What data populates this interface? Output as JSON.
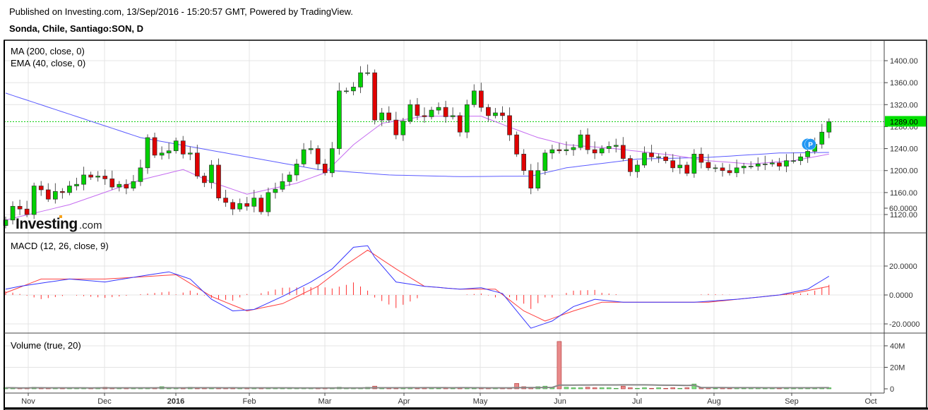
{
  "header": {
    "published": "Published on Investing.com, 13/Sep/2016 - 15:20:57 GMT, Powered by TradingView.",
    "symbol": "Sonda, Chile, Santiago:SON, D"
  },
  "logo": {
    "text_main": "Investing",
    "text_suffix": ".com"
  },
  "chart_data": {
    "type": "candlestick",
    "title": "Sonda, Chile, Santiago:SON, D",
    "x_tick_labels": [
      "Nov",
      "Dec",
      "2016",
      "Feb",
      "Mar",
      "Apr",
      "May",
      "Jun",
      "Jul",
      "Aug",
      "Sep",
      "Oct"
    ],
    "price_panel": {
      "indicators": [
        "MA (200, close, 0)",
        "EMA (40, close, 0)"
      ],
      "y_ticks": [
        "1400.00",
        "1360.00",
        "1320.00",
        "1280.00",
        "1240.00",
        "1200.00",
        "1160.00",
        "1120.00"
      ],
      "ylim": [
        1100,
        1418
      ],
      "last_price": 1289,
      "last_price_label": "1289.00",
      "closes": [
        1110,
        1135,
        1130,
        1120,
        1172,
        1165,
        1148,
        1162,
        1160,
        1172,
        1175,
        1192,
        1188,
        1190,
        1185,
        1170,
        1175,
        1168,
        1180,
        1205,
        1260,
        1228,
        1232,
        1236,
        1254,
        1230,
        1232,
        1190,
        1178,
        1210,
        1150,
        1142,
        1130,
        1140,
        1135,
        1150,
        1125,
        1160,
        1166,
        1180,
        1192,
        1212,
        1238,
        1240,
        1212,
        1196,
        1240,
        1345,
        1345,
        1352,
        1378,
        1378,
        1292,
        1305,
        1292,
        1265,
        1290,
        1320,
        1300,
        1298,
        1310,
        1315,
        1298,
        1300,
        1270,
        1320,
        1345,
        1315,
        1300,
        1305,
        1300,
        1265,
        1230,
        1200,
        1168,
        1200,
        1232,
        1238,
        1236,
        1238,
        1242,
        1265,
        1238,
        1232,
        1240,
        1244,
        1246,
        1222,
        1198,
        1210,
        1232,
        1225,
        1225,
        1218,
        1205,
        1210,
        1195,
        1230,
        1215,
        1205,
        1205,
        1200,
        1196,
        1205,
        1208,
        1208,
        1212,
        1212,
        1214,
        1208,
        1218,
        1218,
        1225,
        1235,
        1248,
        1270,
        1289
      ],
      "first_open": 1100,
      "ma200": [
        [
          0,
          1341
        ],
        [
          19,
          1260
        ],
        [
          34,
          1225
        ],
        [
          44,
          1202
        ],
        [
          54,
          1192
        ],
        [
          64,
          1189
        ],
        [
          74,
          1190
        ],
        [
          79,
          1205
        ],
        [
          89,
          1221
        ],
        [
          99,
          1224
        ],
        [
          109,
          1232
        ],
        [
          116,
          1233
        ]
      ],
      "ema40": [
        [
          0,
          1110
        ],
        [
          9,
          1138
        ],
        [
          19,
          1183
        ],
        [
          25,
          1202
        ],
        [
          29,
          1179
        ],
        [
          34,
          1157
        ],
        [
          41,
          1177
        ],
        [
          45,
          1196
        ],
        [
          49,
          1247
        ],
        [
          53,
          1286
        ],
        [
          59,
          1299
        ],
        [
          67,
          1299
        ],
        [
          71,
          1279
        ],
        [
          75,
          1260
        ],
        [
          79,
          1247
        ],
        [
          85,
          1241
        ],
        [
          94,
          1228
        ],
        [
          99,
          1218
        ],
        [
          105,
          1212
        ],
        [
          111,
          1218
        ],
        [
          116,
          1230
        ]
      ],
      "marker_label": "P"
    },
    "macd_panel": {
      "label": "MACD (12, 26, close, 9)",
      "y_ticks": [
        "60.0000",
        "20.0000",
        "0.0000",
        "-20.0000"
      ],
      "ylim": [
        -38,
        60
      ],
      "macd": [
        [
          0,
          4
        ],
        [
          2,
          6
        ],
        [
          9,
          11
        ],
        [
          14,
          9
        ],
        [
          19,
          13
        ],
        [
          23,
          16
        ],
        [
          26,
          11
        ],
        [
          29,
          -3
        ],
        [
          32,
          -11
        ],
        [
          35,
          -10
        ],
        [
          39,
          -1
        ],
        [
          43,
          9
        ],
        [
          46,
          18
        ],
        [
          49,
          33
        ],
        [
          51,
          34
        ],
        [
          52,
          26
        ],
        [
          55,
          9
        ],
        [
          59,
          6
        ],
        [
          64,
          4
        ],
        [
          67,
          5
        ],
        [
          70,
          1
        ],
        [
          72,
          -11
        ],
        [
          74,
          -23
        ],
        [
          77,
          -18
        ],
        [
          80,
          -8
        ],
        [
          83,
          -3
        ],
        [
          87,
          -5
        ],
        [
          91,
          -5
        ],
        [
          97,
          -5
        ],
        [
          103,
          -3
        ],
        [
          109,
          0
        ],
        [
          113,
          4
        ],
        [
          115,
          10
        ],
        [
          116,
          13
        ]
      ],
      "signal": [
        [
          0,
          1.5
        ],
        [
          5,
          11
        ],
        [
          14,
          11
        ],
        [
          24,
          14
        ],
        [
          29,
          -1
        ],
        [
          34,
          -11
        ],
        [
          39,
          -6
        ],
        [
          44,
          6
        ],
        [
          48,
          21
        ],
        [
          51,
          31
        ],
        [
          55,
          18
        ],
        [
          59,
          6
        ],
        [
          64,
          4
        ],
        [
          69,
          4
        ],
        [
          73,
          -11
        ],
        [
          76,
          -18
        ],
        [
          80,
          -11
        ],
        [
          84,
          -5
        ],
        [
          89,
          -5
        ],
        [
          99,
          -5
        ],
        [
          105,
          -2
        ],
        [
          111,
          1
        ],
        [
          116,
          6
        ]
      ]
    },
    "volume_panel": {
      "label": "Volume (true, 20)",
      "y_ticks": [
        "40M",
        "20M",
        "0"
      ],
      "ylim": [
        0,
        48
      ],
      "volumes_m": [
        1,
        1,
        0.5,
        1,
        1.5,
        1,
        0.5,
        1,
        0.5,
        1,
        1,
        1,
        0.5,
        1,
        1.5,
        1,
        0.5,
        1,
        0.5,
        1,
        1,
        1,
        2,
        1,
        1,
        1,
        1.5,
        0.5,
        1,
        0.5,
        1,
        0.5,
        1,
        0.5,
        1,
        0.5,
        1,
        0.5,
        1,
        0.5,
        1,
        0.5,
        1,
        1,
        0.5,
        1,
        1,
        1.5,
        1,
        1,
        1,
        1.5,
        2.5,
        1,
        1,
        0.5,
        1,
        1,
        0.5,
        1,
        1,
        0.5,
        1,
        0.5,
        1,
        1,
        0.5,
        1,
        0.5,
        1,
        1,
        1,
        5,
        2,
        1.5,
        2,
        2.5,
        1.5,
        44,
        1.5,
        1,
        1,
        1.5,
        1,
        1,
        1,
        0.5,
        2.5,
        1,
        0.5,
        1,
        0.5,
        1,
        0.5,
        1,
        0.5,
        1,
        4.5,
        1,
        1,
        0.5,
        1,
        0.5,
        1,
        0.5,
        1,
        1,
        0.5,
        1,
        0.5,
        1,
        1,
        1,
        0.5,
        1,
        1,
        1
      ]
    }
  },
  "colors": {
    "up": "#00d100",
    "down": "#e00000",
    "ma": "#5b5bff",
    "ema": "#c56cf0",
    "macd": "#3535ff",
    "signal": "#ff4040",
    "hist": "#ff3030",
    "grid": "#e4e4e4",
    "last": "#00cc00",
    "marker": "#2196f3"
  }
}
